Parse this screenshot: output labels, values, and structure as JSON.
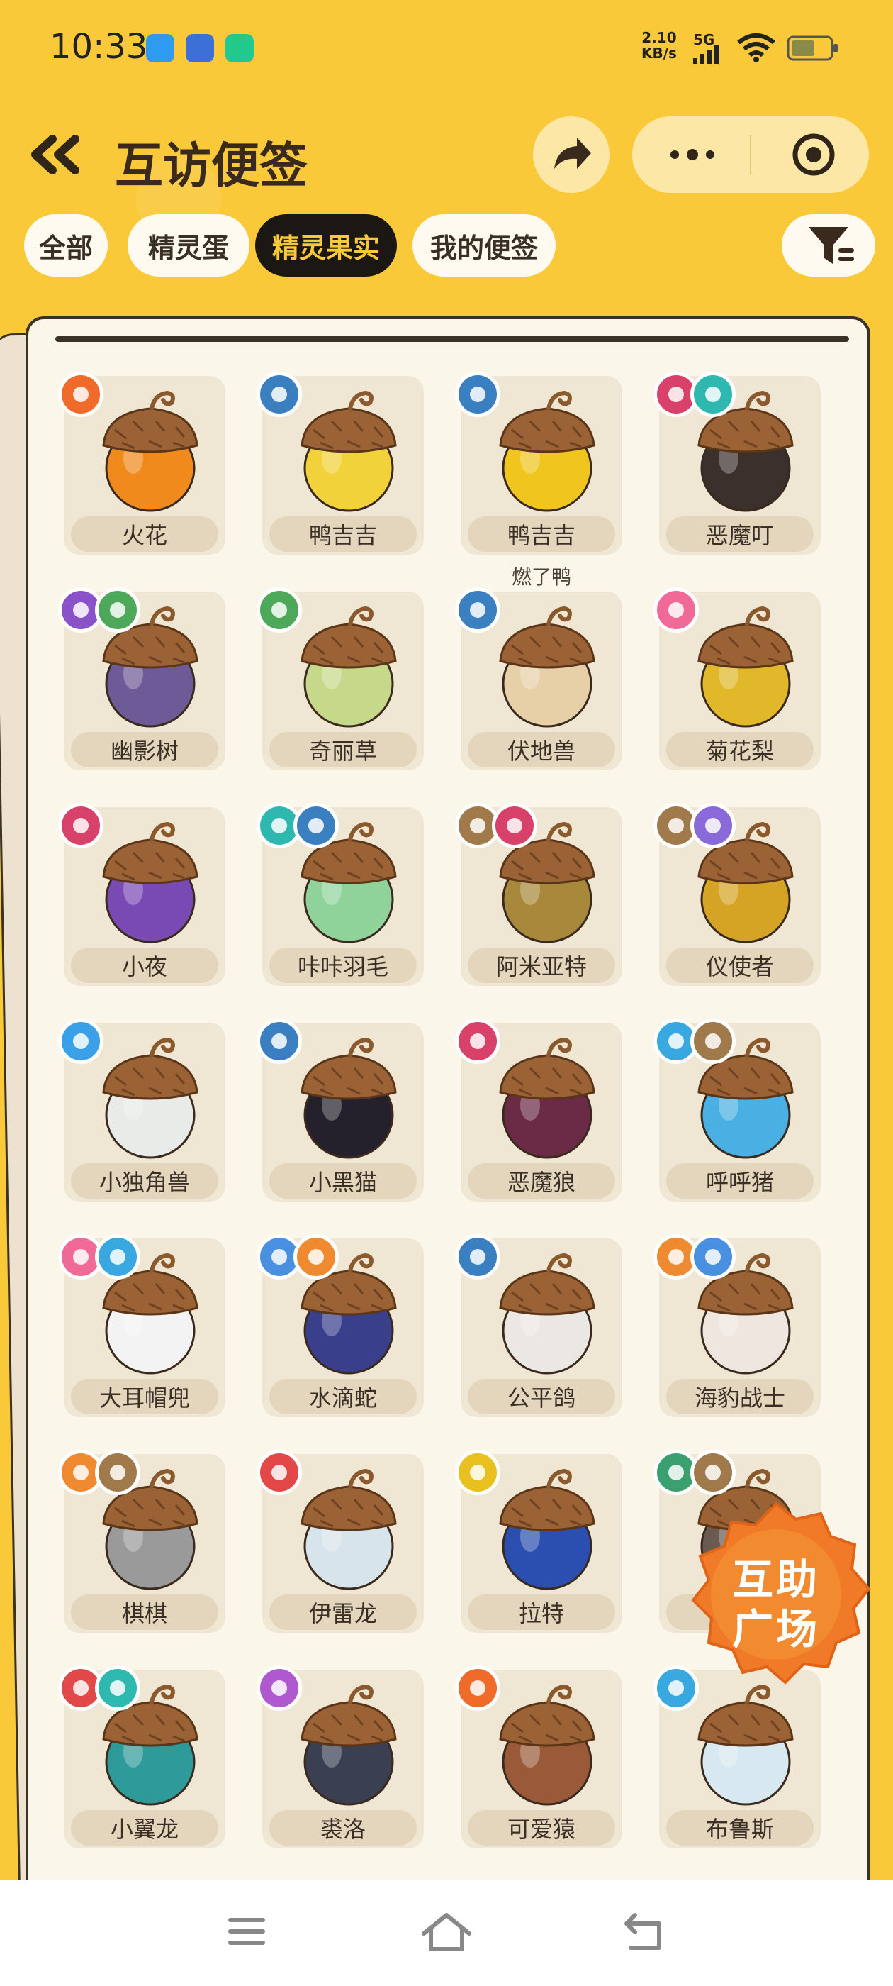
{
  "status": {
    "time": "10:33",
    "speed_value": "2.10",
    "speed_unit": "KB/s",
    "network": "5G"
  },
  "header": {
    "title": "互访便签"
  },
  "tabs": [
    {
      "label": "全部",
      "active": false
    },
    {
      "label": "精灵蛋",
      "active": false
    },
    {
      "label": "精灵果实",
      "active": true
    },
    {
      "label": "我的便签",
      "active": false
    }
  ],
  "items": [
    {
      "name": "火花",
      "subtitle": "",
      "badges": [
        "fire"
      ],
      "color": "#f08a1c"
    },
    {
      "name": "鸭吉吉",
      "subtitle": "",
      "badges": [
        "normal"
      ],
      "color": "#f2d23a"
    },
    {
      "name": "鸭吉吉",
      "subtitle": "燃了鸭",
      "badges": [
        "normal"
      ],
      "color": "#f0c51e"
    },
    {
      "name": "恶魔叮",
      "subtitle": "",
      "badges": [
        "demon",
        "wing"
      ],
      "color": "#3b302b"
    },
    {
      "name": "幽影树",
      "subtitle": "",
      "badges": [
        "ghost",
        "grass"
      ],
      "color": "#6e5a96"
    },
    {
      "name": "奇丽草",
      "subtitle": "",
      "badges": [
        "grass"
      ],
      "color": "#c6d88a"
    },
    {
      "name": "伏地兽",
      "subtitle": "",
      "badges": [
        "normal"
      ],
      "color": "#e7cfa8"
    },
    {
      "name": "菊花梨",
      "subtitle": "",
      "badges": [
        "cute"
      ],
      "color": "#e0b82a"
    },
    {
      "name": "小夜",
      "subtitle": "",
      "badges": [
        "demon"
      ],
      "color": "#7a4ab4"
    },
    {
      "name": "咔咔羽毛",
      "subtitle": "",
      "badges": [
        "wing",
        "normal"
      ],
      "color": "#8fd39b"
    },
    {
      "name": "阿米亚特",
      "subtitle": "",
      "badges": [
        "earth",
        "demon"
      ],
      "color": "#a8883a"
    },
    {
      "name": "仪使者",
      "subtitle": "",
      "badges": [
        "earth",
        "spiral"
      ],
      "color": "#d6a424"
    },
    {
      "name": "小独角兽",
      "subtitle": "",
      "badges": [
        "light"
      ],
      "color": "#e8ebe8"
    },
    {
      "name": "小黑猫",
      "subtitle": "",
      "badges": [
        "normal"
      ],
      "color": "#24202c"
    },
    {
      "name": "恶魔狼",
      "subtitle": "",
      "badges": [
        "demon"
      ],
      "color": "#6b2a46"
    },
    {
      "name": "呼呼猪",
      "subtitle": "",
      "badges": [
        "ice",
        "earth"
      ],
      "color": "#4ab0e4"
    },
    {
      "name": "大耳帽兜",
      "subtitle": "",
      "badges": [
        "cute",
        "ice"
      ],
      "color": "#f3f3f3"
    },
    {
      "name": "水滴蛇",
      "subtitle": "",
      "badges": [
        "water",
        "mech"
      ],
      "color": "#3a3f8c"
    },
    {
      "name": "公平鸽",
      "subtitle": "",
      "badges": [
        "normal"
      ],
      "color": "#ebe7e2"
    },
    {
      "name": "海豹战士",
      "subtitle": "",
      "badges": [
        "mech",
        "water"
      ],
      "color": "#efe7df"
    },
    {
      "name": "棋棋",
      "subtitle": "",
      "badges": [
        "mech",
        "earth"
      ],
      "color": "#9a9a9a"
    },
    {
      "name": "伊雷龙",
      "subtitle": "",
      "badges": [
        "dragon"
      ],
      "color": "#d8e4ec"
    },
    {
      "name": "拉特",
      "subtitle": "",
      "badges": [
        "electric"
      ],
      "color": "#2b4fb0"
    },
    {
      "name": "",
      "subtitle": "",
      "badges": [
        "grass2",
        "earth"
      ],
      "color": "#6b5a50"
    },
    {
      "name": "小翼龙",
      "subtitle": "",
      "badges": [
        "dragon",
        "wing"
      ],
      "color": "#2f9a9a"
    },
    {
      "name": "裘洛",
      "subtitle": "",
      "badges": [
        "poison"
      ],
      "color": "#3b3f52"
    },
    {
      "name": "可爱猿",
      "subtitle": "",
      "badges": [
        "fire"
      ],
      "color": "#9a5a3a"
    },
    {
      "name": "布鲁斯",
      "subtitle": "",
      "badges": [
        "ice"
      ],
      "color": "#d8e8f0"
    }
  ],
  "help_badge": {
    "line1": "互助",
    "line2": "广场"
  },
  "badge_colors": {
    "fire": "#f06a2a",
    "normal": "#3a7fc0",
    "demon": "#d8426a",
    "wing": "#2fb8b0",
    "ghost": "#8a52c8",
    "grass": "#4ea85a",
    "cute": "#f06a98",
    "earth": "#a07a4a",
    "spiral": "#8a6ad8",
    "light": "#3aa0e8",
    "ice": "#3aa8e0",
    "water": "#4a90e0",
    "mech": "#f08a30",
    "dragon": "#e24848",
    "electric": "#e8c020",
    "grass2": "#3aa070",
    "poison": "#b058d0"
  }
}
